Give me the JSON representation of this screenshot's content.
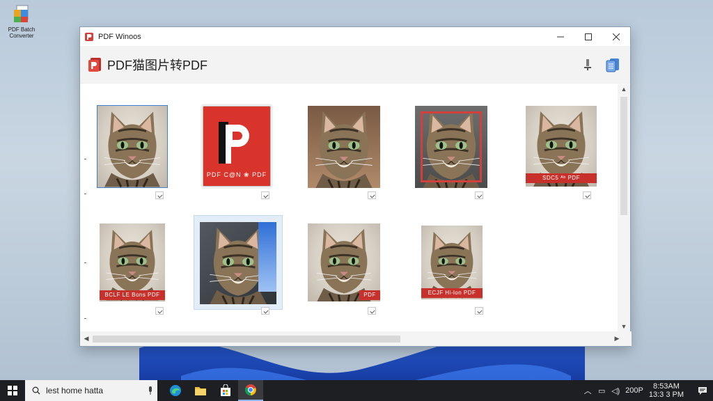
{
  "desktop": {
    "icon_label": "PDF Batch Converter",
    "icon_name": "pdf-app-shortcut-icon"
  },
  "window": {
    "title": "PDF Winoos",
    "header_title": "PDF猫图片转PDF",
    "controls": [
      "minimize",
      "maximize",
      "close"
    ]
  },
  "tiles": [
    {
      "type": "cat",
      "selected": true,
      "frame": "blue",
      "banner": ""
    },
    {
      "type": "pdf",
      "label": "PDF C@N ❀ PDF"
    },
    {
      "type": "cat",
      "banner": ""
    },
    {
      "type": "cat",
      "frame": "red",
      "banner": ""
    },
    {
      "type": "cat",
      "banner": "SDC5 ᴬᵇ PDF"
    },
    {
      "type": "cat",
      "banner": "BCLF LE Bons PDF"
    },
    {
      "type": "cat",
      "selected": true,
      "banner": ""
    },
    {
      "type": "cat",
      "banner": "PDF"
    },
    {
      "type": "cat",
      "banner": "ECJF Hi-lon PDF"
    }
  ],
  "taskbar": {
    "search_text": "lest home hatta",
    "apps": [
      "edge-icon",
      "file-explorer-icon",
      "store-icon",
      "chrome-icon"
    ],
    "zoom": "200P",
    "time": "8:53AM",
    "date": "13:3 3 PM"
  },
  "colors": {
    "accent_red": "#d3403b",
    "select_blue": "#3f7fd0",
    "taskbar": "#1e1f22"
  }
}
